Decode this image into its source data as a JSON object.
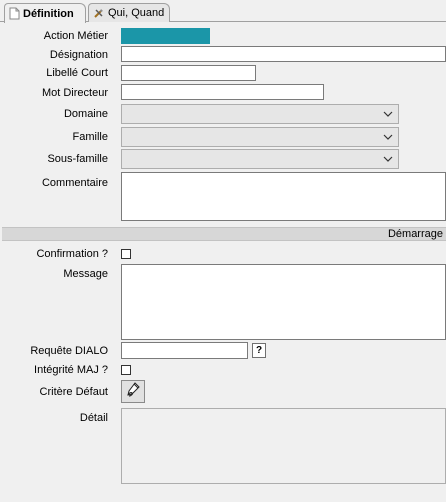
{
  "tabs": [
    {
      "label": "Définition",
      "icon": "document-icon",
      "active": true
    },
    {
      "label": "Qui, Quand",
      "icon": "tools-icon",
      "active": false
    }
  ],
  "fields": {
    "action_metier": {
      "label": "Action Métier",
      "value": ""
    },
    "designation": {
      "label": "Désignation",
      "value": ""
    },
    "libelle_court": {
      "label": "Libellé Court",
      "value": ""
    },
    "mot_directeur": {
      "label": "Mot Directeur",
      "value": ""
    },
    "domaine": {
      "label": "Domaine",
      "value": ""
    },
    "famille": {
      "label": "Famille",
      "value": ""
    },
    "sous_famille": {
      "label": "Sous-famille",
      "value": ""
    },
    "commentaire": {
      "label": "Commentaire",
      "value": ""
    }
  },
  "section": {
    "label": "Démarrage"
  },
  "demarrage": {
    "confirmation": {
      "label": "Confirmation ?",
      "checked": false
    },
    "message": {
      "label": "Message",
      "value": ""
    },
    "requete_dialo": {
      "label": "Requête DIALO",
      "value": "",
      "help_label": "?"
    },
    "integrite_maj": {
      "label": "Intégrité MAJ ?",
      "checked": false
    },
    "critere_defaut": {
      "label": "Critère Défaut",
      "icon": "edit-hand-icon"
    },
    "detail": {
      "label": "Détail",
      "value": ""
    }
  },
  "colors": {
    "accent": "#1b96a8",
    "panel": "#f0f0f0",
    "section_bar": "#d7d7d7"
  }
}
